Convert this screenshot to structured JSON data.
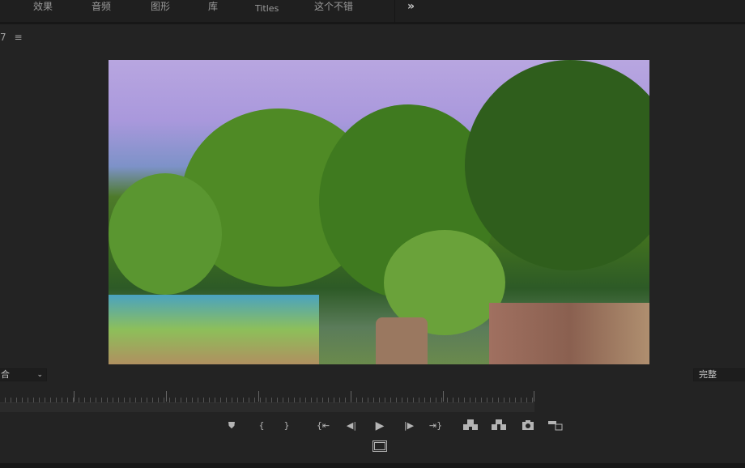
{
  "tabs": [
    {
      "label": "效果"
    },
    {
      "label": "音频"
    },
    {
      "label": "图形"
    },
    {
      "label": "库"
    },
    {
      "label": "Titles"
    },
    {
      "label": "这个不错"
    }
  ],
  "more_label": "»",
  "panel": {
    "title_fragment": "7",
    "menu_icon": "≡"
  },
  "zoom_select": {
    "value": "合"
  },
  "resolution_select": {
    "value": "完整"
  },
  "controls": {
    "marker": "⛊",
    "mark_in": "{",
    "mark_out": "}",
    "go_to_in": "{⇤",
    "step_back": "◀|",
    "play": "▶",
    "step_forward": "|▶",
    "go_to_out": "⇥}",
    "lift": "lift",
    "extract": "extract",
    "export_frame": "camera",
    "button_editor": "button-editor",
    "safe_margins": "safe-margins"
  }
}
